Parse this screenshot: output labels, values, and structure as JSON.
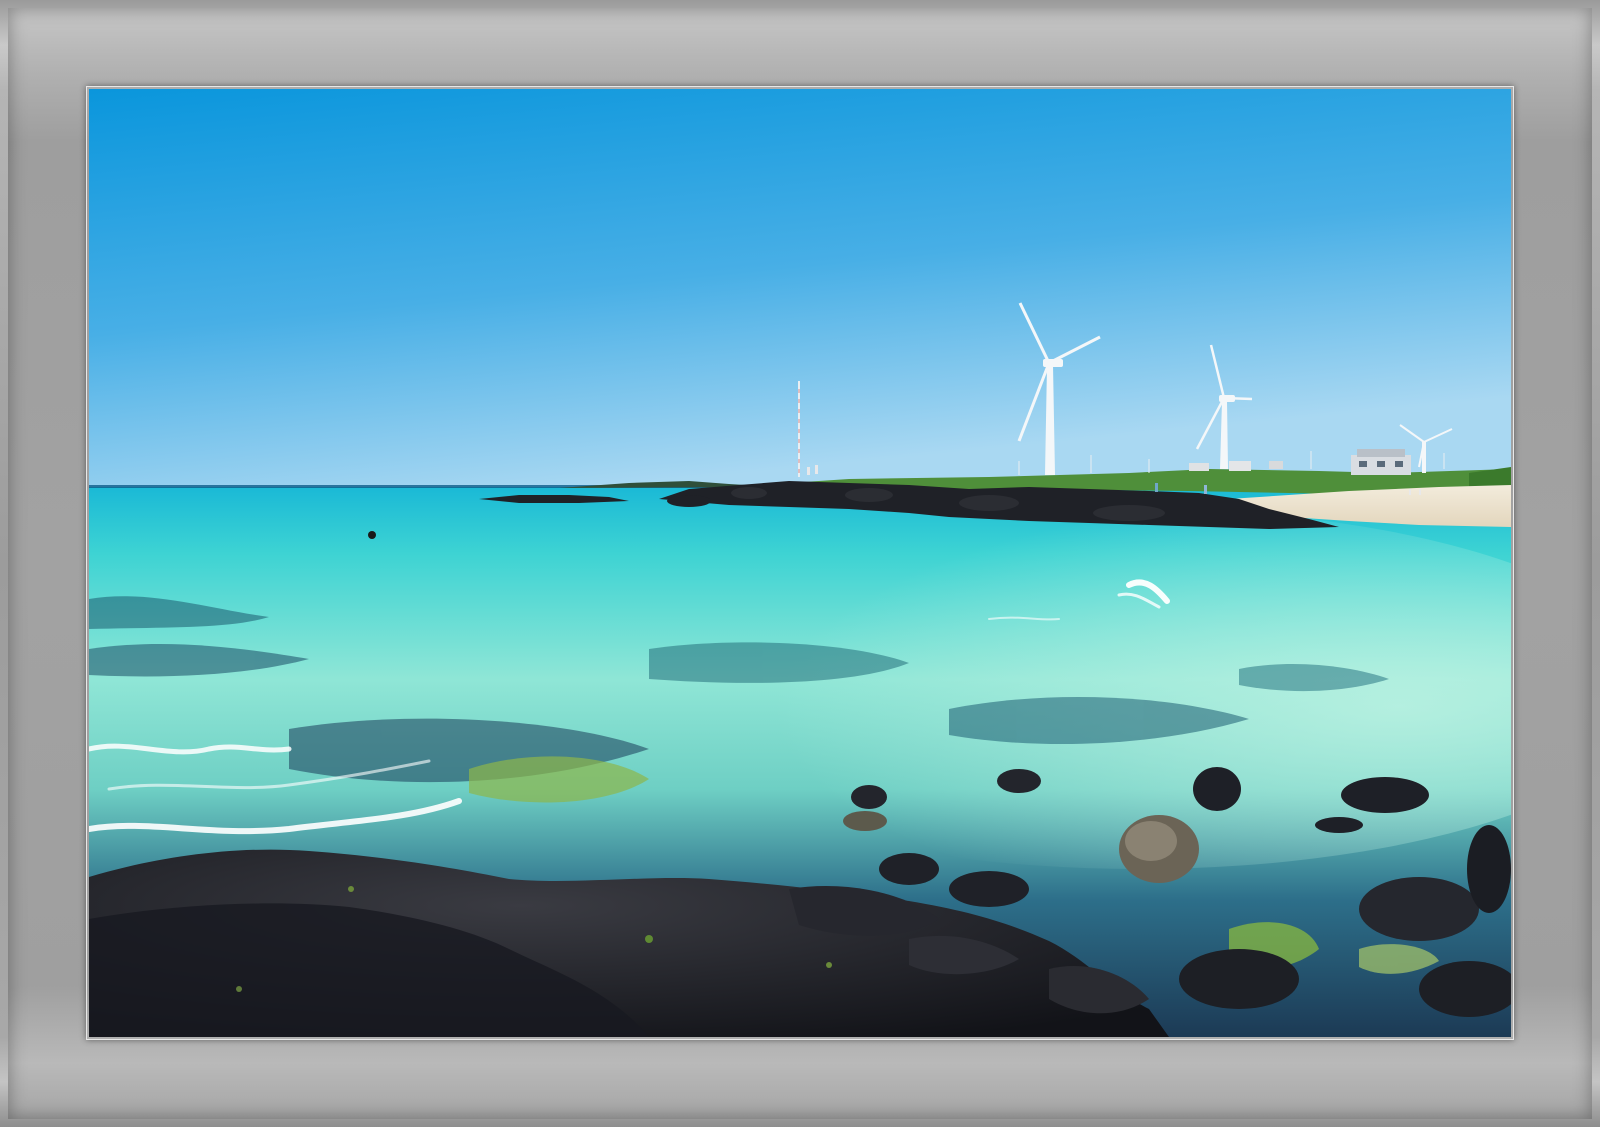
{
  "image": {
    "subject": "coastal-seascape-with-wind-turbines",
    "frame_style": "grey-bevel",
    "colors": {
      "sky_top": "#0f9be0",
      "sky_bottom": "#a9d8f2",
      "sea_far": "#2fd0cf",
      "sea_near": "#9be8d6",
      "lava_rock": "#1d1f26",
      "sand": "#efe7d8",
      "grass": "#4f8f3a"
    },
    "elements": [
      "wind-turbine",
      "wind-turbine",
      "wind-turbine",
      "radio-mast",
      "lava-rock-shore",
      "sand-beach",
      "breaking-waves",
      "swimmer",
      "houses"
    ]
  }
}
